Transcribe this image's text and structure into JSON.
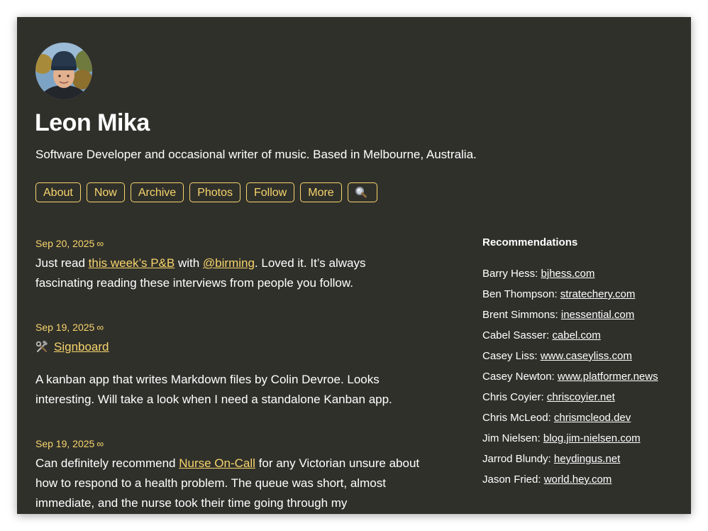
{
  "header": {
    "name": "Leon Mika",
    "tagline": "Software Developer and occasional writer of music. Based in Melbourne, Australia."
  },
  "nav": {
    "items": [
      "About",
      "Now",
      "Archive",
      "Photos",
      "Follow",
      "More"
    ],
    "search_icon": "magnifying-glass-icon"
  },
  "posts": [
    {
      "date": "Sep 20, 2025",
      "perma": "∞",
      "before": "Just read ",
      "link1": "this week’s P&B",
      "mid": " with ",
      "link2": "@birming",
      "after": ". Loved it. It’s always fascinating reading these interviews from people you follow."
    },
    {
      "date": "Sep 19, 2025",
      "perma": "∞",
      "icon": "hammer-and-wrench-icon",
      "title_link": "Signboard",
      "body": "A kanban app that writes Markdown files by Colin Devroe. Looks interesting. Will take a look when I need a standalone Kanban app."
    },
    {
      "date": "Sep 19, 2025",
      "perma": "∞",
      "before": "Can definitely recommend ",
      "link": "Nurse On-Call",
      "after": " for any Victorian unsure about how to respond to a health problem. The queue was short, almost immediate, and the nurse took their time going through my"
    }
  ],
  "sidebar": {
    "heading": "Recommendations",
    "items": [
      {
        "name": "Barry Hess:",
        "site": "bjhess.com"
      },
      {
        "name": "Ben Thompson:",
        "site": "stratechery.com"
      },
      {
        "name": "Brent Simmons:",
        "site": "inessential.com"
      },
      {
        "name": "Cabel Sasser:",
        "site": "cabel.com"
      },
      {
        "name": "Casey Liss:",
        "site": "www.caseyliss.com"
      },
      {
        "name": "Casey Newton:",
        "site": "www.platformer.news"
      },
      {
        "name": "Chris Coyier:",
        "site": "chriscoyier.net"
      },
      {
        "name": "Chris McLeod:",
        "site": "chrismcleod.dev"
      },
      {
        "name": "Jim Nielsen:",
        "site": "blog.jim-nielsen.com"
      },
      {
        "name": "Jarrod Blundy:",
        "site": "heydingus.net"
      },
      {
        "name": "Jason Fried:",
        "site": "world.hey.com"
      }
    ]
  },
  "colors": {
    "background": "#30302b",
    "accent": "#f7d56b",
    "text": "#ffffff"
  }
}
